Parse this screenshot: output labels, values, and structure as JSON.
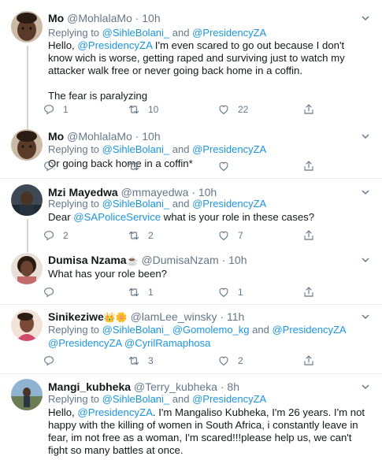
{
  "tweets": [
    {
      "name": "Mo",
      "handle": "@MohlalaMo",
      "time": "10h",
      "reply_prefix": "Replying to",
      "reply_users": [
        "@SihleBolani_",
        "@PresidencyZA"
      ],
      "reply_joiner": "and",
      "text_parts": [
        "Hello, ",
        "@PresidencyZA",
        " I'm even scared to go out because I don't know wich is worse, getting raped and surviving just to watch my attacker walk free or never going back home in a coffin."
      ],
      "text_extra": "The fear is paralyzing",
      "replies": "1",
      "retweets": "10",
      "likes": "22"
    },
    {
      "name": "Mo",
      "handle": "@MohlalaMo",
      "time": "10h",
      "reply_prefix": "Replying to",
      "reply_users": [
        "@SihleBolani_",
        "@PresidencyZA"
      ],
      "reply_joiner": "and",
      "text_parts": [
        "Or going back home in a coffin*"
      ],
      "replies": "",
      "retweets": "",
      "likes": ""
    },
    {
      "name": "Mzi Mayedwa",
      "handle": "@mmayedwa",
      "time": "10h",
      "reply_prefix": "Replying to",
      "reply_users": [
        "@SihleBolani_",
        "@PresidencyZA"
      ],
      "reply_joiner": "and",
      "text_parts": [
        "Dear ",
        "@SAPoliceService",
        " what is your role in these cases?"
      ],
      "replies": "2",
      "retweets": "2",
      "likes": "7"
    },
    {
      "name": "Dumisa Nzama",
      "name_emoji": "☕",
      "handle": "@DumisaNzam",
      "time": "10h",
      "text_parts": [
        "What has your role been?"
      ],
      "replies": "",
      "retweets": "1",
      "likes": "1"
    },
    {
      "name": "Sinikeziwe",
      "name_emoji": "👑🌼",
      "handle": "@lamLee_winsky",
      "time": "11h",
      "reply_prefix": "Replying to",
      "reply_users": [
        "@SihleBolani_",
        "@Gomolemo_kg",
        "@PresidencyZA"
      ],
      "reply_joiner": "and",
      "reply_users_line2": "@PresidencyZA @CyrilRamaphosa",
      "replies": "",
      "retweets": "3",
      "likes": "2"
    },
    {
      "name": "Mangi_kubheka",
      "handle": "@Terry_kubheka",
      "time": "8h",
      "reply_prefix": "Replying to",
      "reply_users": [
        "@SihleBolani_",
        "@PresidencyZA"
      ],
      "reply_joiner": "and",
      "text_parts": [
        "Hello, ",
        "@PresidencyZA",
        ". I'm Mangaliso Kubheka, I'm 26 years. I'm not happy with the killing of women in South Africa, i constantly leave in fear, im not free as a woman, I'm scared!!!please help us, we can't fight so many battles at once."
      ]
    }
  ],
  "separator": "·",
  "colors": {
    "link": "#1b95e0",
    "muted": "#657786",
    "text": "#14171a",
    "divider": "#e6ecf0"
  },
  "icons": [
    "reply-icon",
    "retweet-icon",
    "like-icon",
    "share-icon",
    "chevron-down-icon"
  ]
}
